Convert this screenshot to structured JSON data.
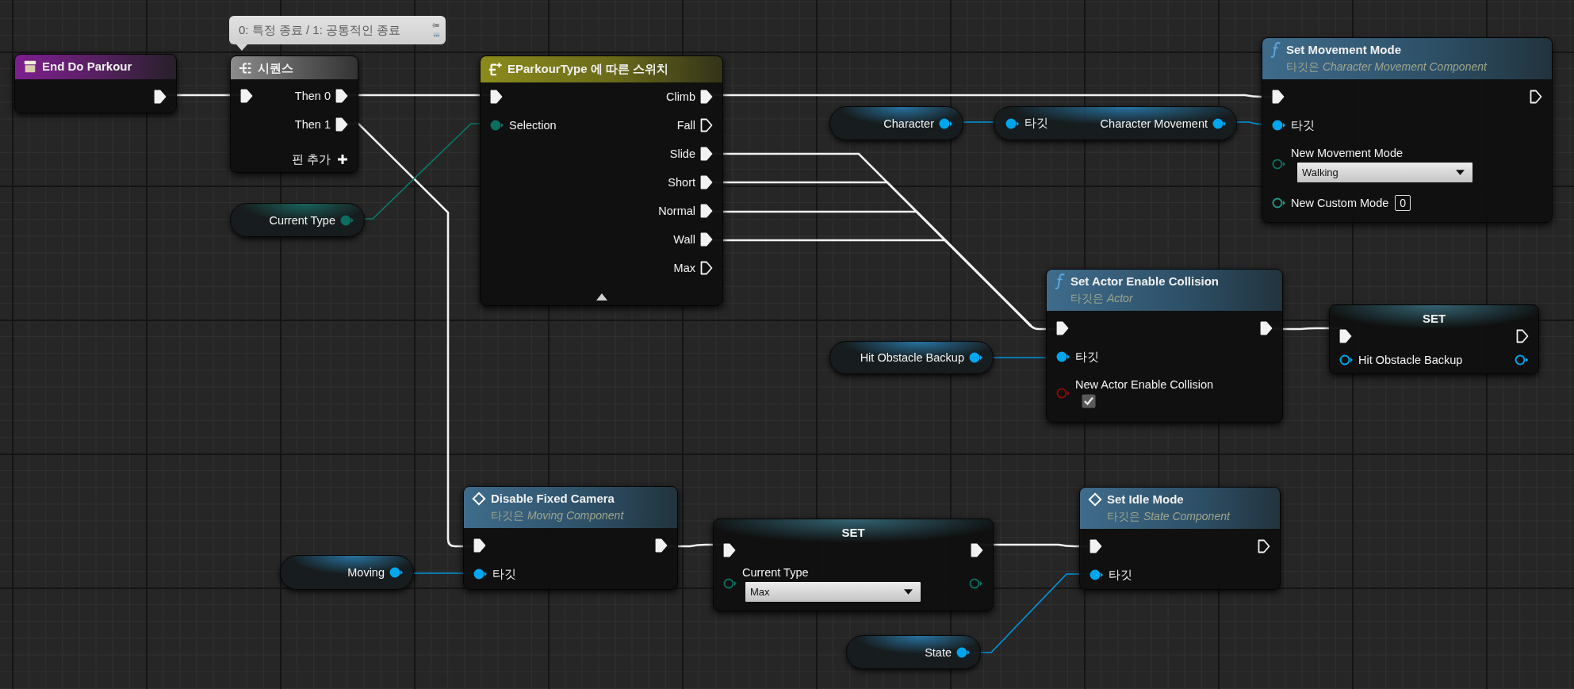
{
  "comment": {
    "text": "0: 특정 종료 / 1: 공통적인 종료"
  },
  "nodes": [
    {
      "kind": "event",
      "title": "End Do Parkour",
      "rows": [
        {
          "right": {
            "kind": "exec",
            "connected": true
          }
        }
      ]
    },
    {
      "kind": "sequence",
      "title": "시퀀스",
      "rows": [
        {
          "left": {
            "kind": "exec",
            "connected": true
          },
          "right": {
            "kind": "exec",
            "connected": true,
            "label": "Then 0"
          }
        },
        {
          "right": {
            "kind": "exec",
            "connected": true,
            "label": "Then 1"
          }
        },
        {
          "right": {
            "kind": "add",
            "label": "핀 추가"
          }
        }
      ]
    },
    {
      "kind": "variable",
      "name": "Current Type",
      "pin": {
        "kind": "enum",
        "connected": true
      }
    },
    {
      "kind": "switch",
      "title": "EParkourType 에 따른 스위치",
      "rows": [
        {
          "left": {
            "kind": "exec",
            "connected": true
          },
          "right": {
            "kind": "exec",
            "connected": true,
            "label": "Climb"
          }
        },
        {
          "left": {
            "kind": "enum",
            "connected": true,
            "label": "Selection"
          },
          "right": {
            "kind": "exec",
            "connected": false,
            "label": "Fall"
          }
        },
        {
          "right": {
            "kind": "exec",
            "connected": true,
            "label": "Slide"
          }
        },
        {
          "right": {
            "kind": "exec",
            "connected": true,
            "label": "Short"
          }
        },
        {
          "right": {
            "kind": "exec",
            "connected": true,
            "label": "Normal"
          }
        },
        {
          "right": {
            "kind": "exec",
            "connected": true,
            "label": "Wall"
          }
        },
        {
          "right": {
            "kind": "exec",
            "connected": false,
            "label": "Max"
          }
        }
      ]
    },
    {
      "kind": "variable",
      "name": "Character",
      "pin": {
        "kind": "object",
        "connected": true
      }
    },
    {
      "kind": "getter",
      "rows": [
        {
          "left": {
            "kind": "object",
            "connected": true,
            "label": "타깃"
          },
          "right": {
            "kind": "object",
            "connected": true,
            "label": "Character Movement"
          }
        }
      ]
    },
    {
      "kind": "function",
      "title": "Set Movement Mode",
      "subtitle": "타깃은 *Character Movement Component*",
      "rows": [
        {
          "left": {
            "kind": "exec",
            "connected": true
          },
          "right": {
            "kind": "exec",
            "connected": false
          }
        },
        {
          "left": {
            "kind": "object",
            "connected": true,
            "label": "타깃"
          }
        },
        {
          "left": {
            "kind": "enum",
            "connected": false,
            "label": "New Movement Mode"
          },
          "field": {
            "kind": "dropdown",
            "value": "Walking"
          }
        },
        {
          "left": {
            "kind": "int",
            "connected": false,
            "label": "New Custom Mode"
          },
          "field": {
            "kind": "number",
            "value": "0"
          }
        }
      ]
    },
    {
      "kind": "function",
      "title": "Set Actor Enable Collision",
      "subtitle": "타깃은 *Actor*",
      "rows": [
        {
          "left": {
            "kind": "exec",
            "connected": true
          },
          "right": {
            "kind": "exec",
            "connected": true
          }
        },
        {
          "left": {
            "kind": "object",
            "connected": true,
            "label": "타깃"
          }
        },
        {
          "left": {
            "kind": "bool",
            "connected": false,
            "label": "New Actor Enable Collision"
          },
          "field": {
            "kind": "checkbox",
            "checked": true
          }
        }
      ]
    },
    {
      "kind": "variable",
      "name": "Hit Obstacle Backup",
      "pin": {
        "kind": "object",
        "connected": true
      }
    },
    {
      "kind": "set",
      "title": "SET",
      "rows": [
        {
          "left": {
            "kind": "exec",
            "connected": true
          },
          "right": {
            "kind": "exec",
            "connected": false
          }
        },
        {
          "left": {
            "kind": "object",
            "connected": false,
            "label": "Hit Obstacle Backup"
          },
          "right": {
            "kind": "object",
            "connected": false
          }
        }
      ]
    },
    {
      "kind": "variable",
      "name": "Moving",
      "pin": {
        "kind": "object",
        "connected": true
      }
    },
    {
      "kind": "function",
      "title": "Disable Fixed Camera",
      "subtitle": "타깃은 *Moving Component*",
      "rows": [
        {
          "left": {
            "kind": "exec",
            "connected": true
          },
          "right": {
            "kind": "exec",
            "connected": true
          }
        },
        {
          "left": {
            "kind": "object",
            "connected": true,
            "label": "타깃"
          }
        }
      ]
    },
    {
      "kind": "set",
      "title": "SET",
      "rows": [
        {
          "left": {
            "kind": "exec",
            "connected": true
          },
          "right": {
            "kind": "exec",
            "connected": true
          }
        },
        {
          "left": {
            "kind": "enum",
            "connected": false,
            "label": "Current Type"
          },
          "right": {
            "kind": "enum",
            "connected": false
          },
          "field": {
            "kind": "dropdown",
            "value": "Max"
          }
        }
      ]
    },
    {
      "kind": "function",
      "title": "Set Idle Mode",
      "subtitle": "타깃은 *State Component*",
      "rows": [
        {
          "left": {
            "kind": "exec",
            "connected": true
          },
          "right": {
            "kind": "exec",
            "connected": false
          }
        },
        {
          "left": {
            "kind": "object",
            "connected": true,
            "label": "타깃"
          }
        }
      ]
    },
    {
      "kind": "variable",
      "name": "State",
      "pin": {
        "kind": "object",
        "connected": true
      }
    }
  ]
}
